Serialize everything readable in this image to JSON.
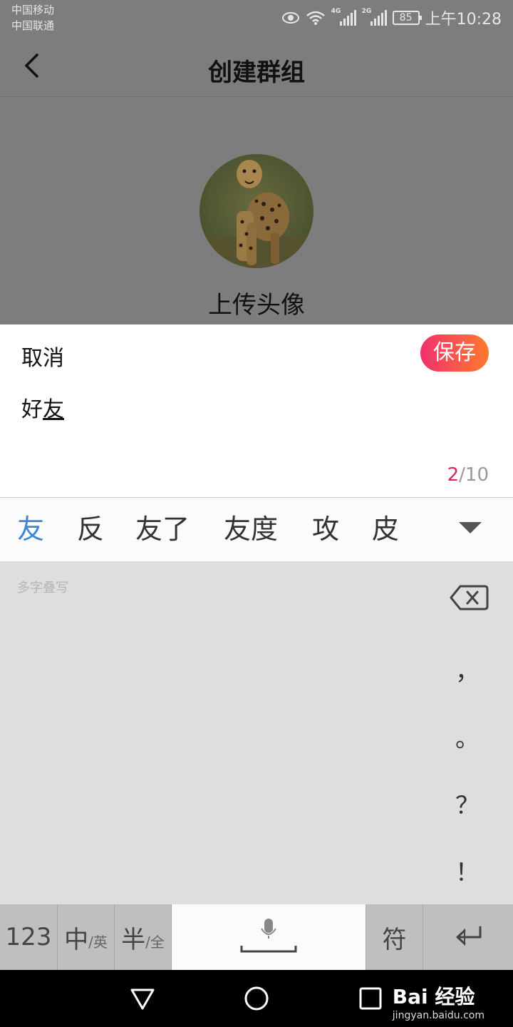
{
  "status_bar": {
    "carrier_1": "中国移动",
    "carrier_2": "中国联通",
    "signal_1_tag": "4G",
    "signal_2_tag": "2G",
    "battery": "85",
    "time": "上午10:28"
  },
  "header": {
    "title": "创建群组",
    "back_icon": "chevron-left-icon"
  },
  "group": {
    "avatar_icon": "cheetah-photo",
    "upload_label": "上传头像"
  },
  "edit_sheet": {
    "cancel_label": "取消",
    "save_label": "保存",
    "input_committed": "好",
    "input_composing": "友",
    "char_count": "2",
    "char_limit": "/10"
  },
  "candidates": [
    "友",
    "反",
    "友了",
    "友度",
    "攻",
    "皮"
  ],
  "handwriting": {
    "hint": "多字叠写",
    "punctuation": [
      "，",
      "。",
      "？",
      "！"
    ]
  },
  "keyboard": {
    "num_key": "123",
    "lang_main": "中",
    "lang_sub": "/英",
    "width_main": "半",
    "width_sub": "/全",
    "symbol_key": "符"
  },
  "watermark": {
    "text": "Bai 经验",
    "url": "jingyan.baidu.com"
  },
  "colors": {
    "accent_blue": "#3c86d8",
    "save_gradient_start": "#f0306e",
    "save_gradient_end": "#ff7a2e",
    "counter_red": "#e0245e"
  }
}
